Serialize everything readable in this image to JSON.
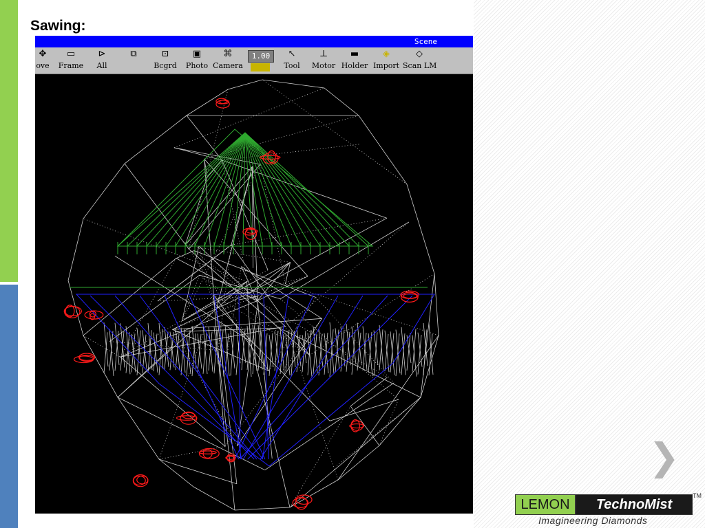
{
  "slide": {
    "title": "Sawing:"
  },
  "window": {
    "title": "Scene",
    "zoom_value": "1.00",
    "toolbar": [
      {
        "id": "move",
        "label": "ove",
        "icon": "move-icon",
        "glyph": "✥"
      },
      {
        "id": "frame",
        "label": "Frame",
        "icon": "frame-icon",
        "glyph": "▭"
      },
      {
        "id": "all",
        "label": "All",
        "icon": "all-icon",
        "glyph": "⊳"
      },
      {
        "id": "window",
        "label": "",
        "icon": "windows-icon",
        "glyph": "⧉"
      },
      {
        "id": "bcgrd",
        "label": "Bcgrd",
        "icon": "background-icon",
        "glyph": "⊡"
      },
      {
        "id": "photo",
        "label": "Photo",
        "icon": "photo-icon",
        "glyph": "▣"
      },
      {
        "id": "camera",
        "label": "Camera",
        "icon": "camera-icon",
        "glyph": "⌘"
      },
      {
        "id": "tool",
        "label": "Tool",
        "icon": "cursor-icon",
        "glyph": "↖"
      },
      {
        "id": "motor",
        "label": "Motor",
        "icon": "motor-icon",
        "glyph": "⊥"
      },
      {
        "id": "holder",
        "label": "Holder",
        "icon": "holder-icon",
        "glyph": "▬"
      },
      {
        "id": "import",
        "label": "Import",
        "icon": "import-icon",
        "glyph": "◈"
      },
      {
        "id": "scanlm",
        "label": "Scan LM",
        "icon": "scan-icon",
        "glyph": "◇"
      }
    ]
  },
  "logo": {
    "part1": "LEMON",
    "part2": "TechnoMist",
    "tm": "TM",
    "tagline": "Imagineering  Diamonds"
  },
  "nav": {
    "next_glyph": "❯"
  },
  "colors": {
    "green_bar": "#92d050",
    "blue_bar": "#4f81bd",
    "titlebar": "#0000ff",
    "wire": "#cccccc",
    "red": "#ff0000",
    "green": "#2fa82f",
    "blue": "#1a1aff"
  }
}
